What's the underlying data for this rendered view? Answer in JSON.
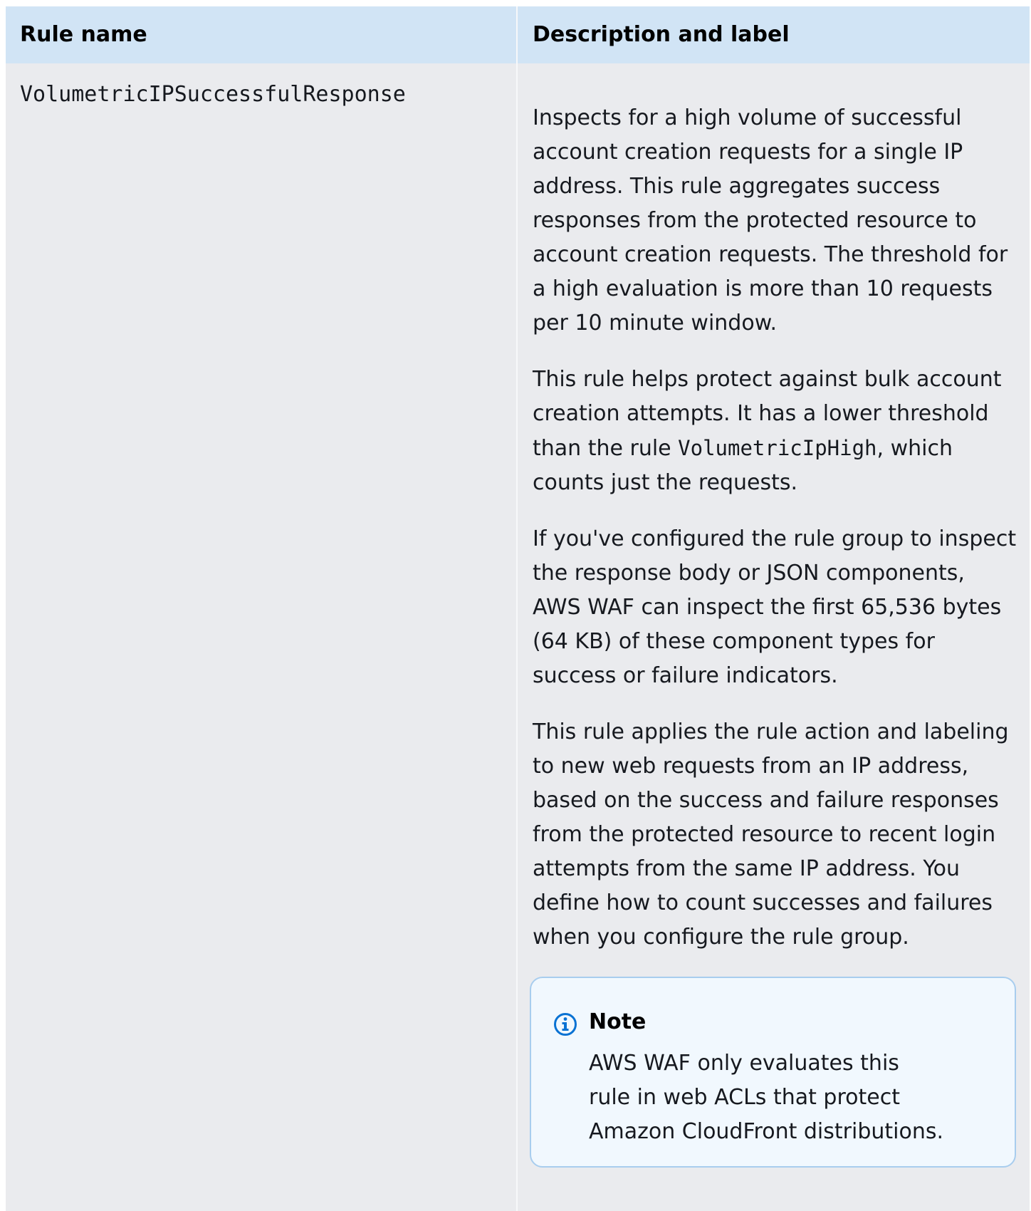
{
  "table": {
    "headers": [
      "Rule name",
      "Description and label"
    ]
  },
  "row": {
    "rule_name": "VolumetricIPSuccessfulResponse",
    "description": {
      "p1": "Inspects for a high volume of successful account creation requests for a single IP address. This rule aggregates success responses from the protected resource to account creation requests. The threshold for a high evaluation is more than 10 requests per 10 minute window.",
      "p2_before": "This rule helps protect against bulk account creation attempts. It has a lower threshold than the rule ",
      "p2_code": "VolumetricIpHigh",
      "p2_after": ", which counts just the requests.",
      "p3": "If you've configured the rule group to inspect the response body or JSON components, AWS WAF can inspect the first 65,536 bytes (64 KB) of these component types for success or failure indicators.",
      "p4": "This rule applies the rule action and labeling to new web requests from an IP address, based on the success and failure responses from the protected resource to recent login attempts from the same IP address. You define how to count successes and failures when you configure the rule group."
    },
    "note": {
      "icon": "info-icon",
      "title": "Note",
      "body": "AWS WAF only evaluates this rule in web ACLs that protect Amazon CloudFront distributions."
    }
  },
  "colors": {
    "header_bg": "#d1e4f5",
    "cell_bg": "#eaebee",
    "note_bg": "#f1f8fe",
    "note_border": "#a8cdee",
    "info_icon": "#0972d3"
  }
}
